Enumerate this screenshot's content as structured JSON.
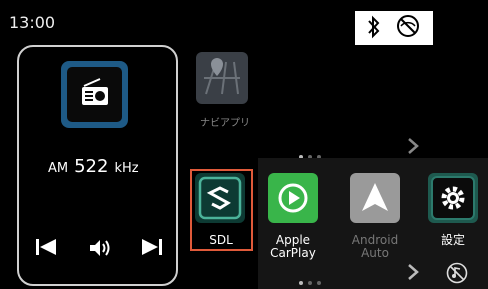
{
  "status": {
    "time": "13:00",
    "icons": [
      "bluetooth-icon",
      "no-signal-icon"
    ]
  },
  "radio": {
    "band": "AM",
    "frequency": "522",
    "unit": "kHz",
    "controls": [
      "previous-icon",
      "volume-icon",
      "next-icon"
    ]
  },
  "top_row": {
    "apps": [
      {
        "label": "ナビアプリ",
        "icon": "map-icon"
      }
    ],
    "page_indicator": {
      "pages": 3,
      "current": 1
    }
  },
  "bottom_row": {
    "apps": [
      {
        "label": "SDL",
        "icon": "sdl-icon",
        "selected": true
      },
      {
        "label": "Apple CarPlay",
        "icon": "carplay-icon",
        "selected": false
      },
      {
        "label": "Android Auto",
        "icon": "android-auto-icon",
        "selected": false
      },
      {
        "label": "設定",
        "icon": "gear-icon",
        "selected": false
      }
    ],
    "page_indicator": {
      "pages": 3,
      "current": 1
    }
  },
  "colors": {
    "selection": "#e05a3a",
    "radio_accent": "#1e5a86",
    "carplay": "#39b54a"
  }
}
